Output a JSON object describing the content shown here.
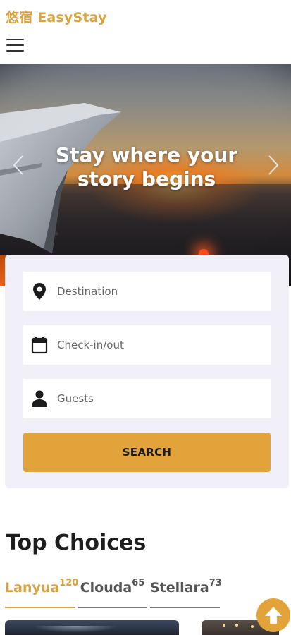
{
  "header": {
    "brand": "悠宿 EasyStay",
    "menu_icon": "hamburger-menu-icon"
  },
  "hero": {
    "title": "Stay where your story begins",
    "prev_icon": "chevron-left-icon",
    "next_icon": "chevron-right-icon"
  },
  "search": {
    "destination": {
      "placeholder": "Destination",
      "value": "",
      "icon": "location-pin-icon"
    },
    "dates": {
      "placeholder": "Check-in/out",
      "value": "",
      "icon": "calendar-icon"
    },
    "guests": {
      "placeholder": "Guests",
      "value": "",
      "icon": "person-icon"
    },
    "button_label": "SEARCH"
  },
  "top_choices": {
    "title": "Top Choices",
    "tabs": [
      {
        "label": "Lanyua",
        "count": "120",
        "active": true
      },
      {
        "label": "Clouda",
        "count": "65",
        "active": false
      },
      {
        "label": "Stellara",
        "count": "73",
        "active": false
      }
    ]
  },
  "scroll_top_icon": "arrow-up-icon",
  "colors": {
    "accent": "#e2a43a",
    "brand_text": "#d9a23f",
    "card_bg": "#f1eff8"
  }
}
